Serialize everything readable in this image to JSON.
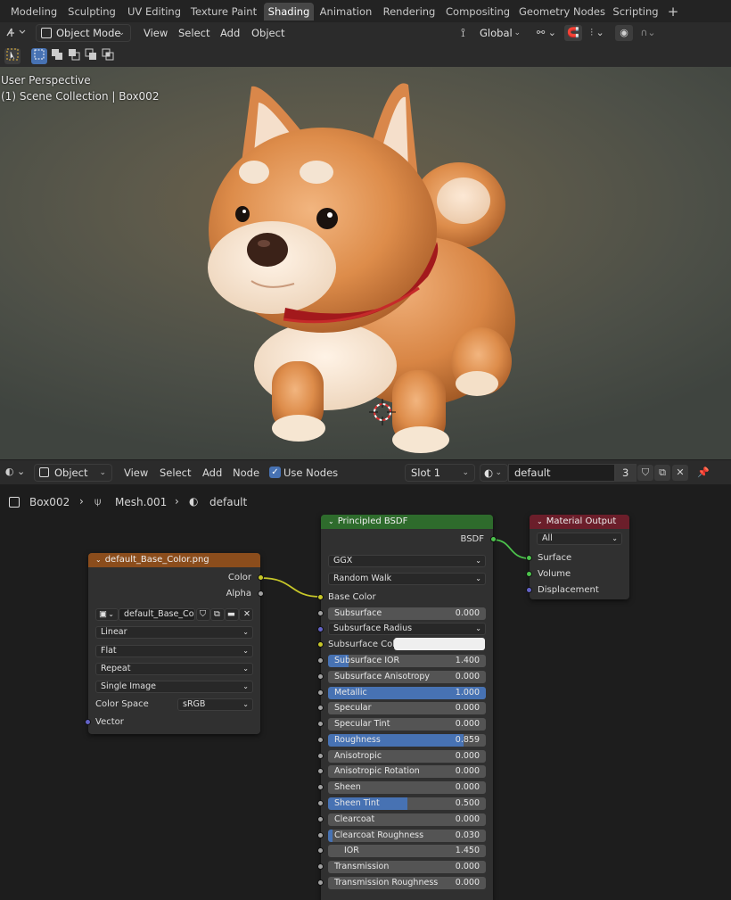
{
  "workspace_tabs": [
    "Modeling",
    "Sculpting",
    "UV Editing",
    "Texture Paint",
    "Shading",
    "Animation",
    "Rendering",
    "Compositing",
    "Geometry Nodes",
    "Scripting"
  ],
  "active_tab": "Shading",
  "add_tab_icon": "plus-icon",
  "viewport_header": {
    "mode": "Object Mode",
    "menus": [
      "View",
      "Select",
      "Add",
      "Object"
    ],
    "transform_orientation": "Global"
  },
  "viewport": {
    "perspective": "User Perspective",
    "collection": "(1) Scene Collection | Box002"
  },
  "node_header": {
    "object_dropdown": "Object",
    "menus": [
      "View",
      "Select",
      "Add",
      "Node"
    ],
    "use_nodes_label": "Use Nodes",
    "use_nodes_checked": true,
    "slot": "Slot 1",
    "material_name": "default",
    "users": "3"
  },
  "breadcrumb": {
    "object": "Box002",
    "mesh": "Mesh.001",
    "material": "default"
  },
  "image_node": {
    "title": "default_Base_Color.png",
    "outputs": [
      "Color",
      "Alpha"
    ],
    "image_name": "default_Base_Colo...",
    "interpolation": "Linear",
    "projection": "Flat",
    "extension": "Repeat",
    "source": "Single Image",
    "color_space_label": "Color Space",
    "color_space": "sRGB",
    "input": "Vector",
    "header_color": "#8b4d1c"
  },
  "bsdf_node": {
    "title": "Principled BSDF",
    "output": "BSDF",
    "distribution": "GGX",
    "subsurface_method": "Random Walk",
    "base_color_label": "Base Color",
    "subsurface_radius_label": "Subsurface Radius",
    "subsurface_color_label": "Subsurface Colo",
    "header_color": "#2e6b2c",
    "fields": [
      {
        "label": "Subsurface",
        "value": "0.000",
        "fraction": 0
      },
      {
        "label": "Subsurface IOR",
        "value": "1.400",
        "fraction": 0.13
      },
      {
        "label": "Subsurface Anisotropy",
        "value": "0.000",
        "fraction": 0
      },
      {
        "label": "Metallic",
        "value": "1.000",
        "fraction": 1
      },
      {
        "label": "Specular",
        "value": "0.000",
        "fraction": 0
      },
      {
        "label": "Specular Tint",
        "value": "0.000",
        "fraction": 0
      },
      {
        "label": "Roughness",
        "value": "0.859",
        "fraction": 0.859
      },
      {
        "label": "Anisotropic",
        "value": "0.000",
        "fraction": 0
      },
      {
        "label": "Anisotropic Rotation",
        "value": "0.000",
        "fraction": 0
      },
      {
        "label": "Sheen",
        "value": "0.000",
        "fraction": 0
      },
      {
        "label": "Sheen Tint",
        "value": "0.500",
        "fraction": 0.5
      },
      {
        "label": "Clearcoat",
        "value": "0.000",
        "fraction": 0
      },
      {
        "label": "Clearcoat Roughness",
        "value": "0.030",
        "fraction": 0.03
      },
      {
        "label": "IOR",
        "value": "1.450",
        "fraction": 0
      },
      {
        "label": "Transmission",
        "value": "0.000",
        "fraction": 0
      },
      {
        "label": "Transmission Roughness",
        "value": "0.000",
        "fraction": 0
      }
    ]
  },
  "output_node": {
    "title": "Material Output",
    "target": "All",
    "inputs": [
      "Surface",
      "Volume",
      "Displacement"
    ],
    "header_color": "#6b1e2a"
  },
  "colors": {
    "accent": "#4772b3",
    "color_socket": "#c7c729",
    "shader_socket": "#4cc24c",
    "vector_socket": "#6363c7",
    "value_socket": "#a1a1a1"
  }
}
